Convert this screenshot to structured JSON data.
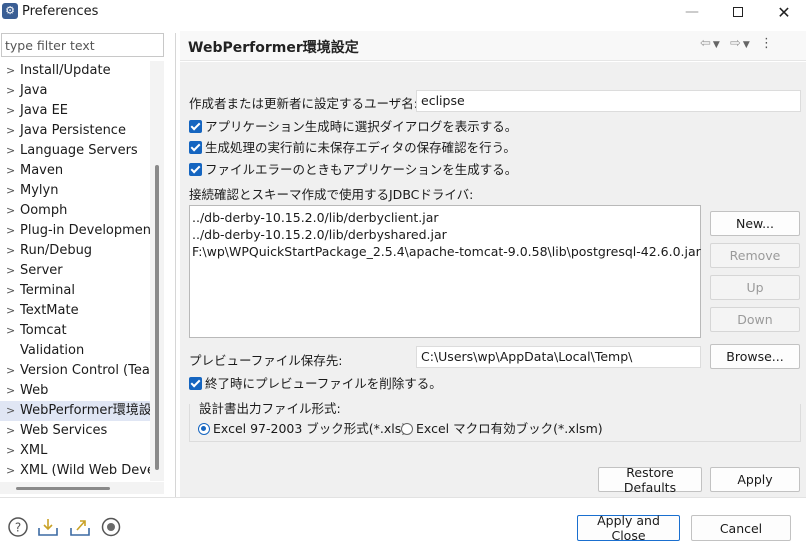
{
  "window": {
    "title": "Preferences"
  },
  "filter": {
    "placeholder": "type filter text"
  },
  "tree": {
    "items": [
      {
        "label": "Install/Update",
        "expandable": true
      },
      {
        "label": "Java",
        "expandable": true
      },
      {
        "label": "Java EE",
        "expandable": true
      },
      {
        "label": "Java Persistence",
        "expandable": true
      },
      {
        "label": "Language Servers",
        "expandable": true
      },
      {
        "label": "Maven",
        "expandable": true
      },
      {
        "label": "Mylyn",
        "expandable": true
      },
      {
        "label": "Oomph",
        "expandable": true
      },
      {
        "label": "Plug-in Development",
        "expandable": true
      },
      {
        "label": "Run/Debug",
        "expandable": true
      },
      {
        "label": "Server",
        "expandable": true
      },
      {
        "label": "Terminal",
        "expandable": true
      },
      {
        "label": "TextMate",
        "expandable": true
      },
      {
        "label": "Tomcat",
        "expandable": true
      },
      {
        "label": "Validation",
        "expandable": false
      },
      {
        "label": "Version Control (Team)",
        "expandable": true
      },
      {
        "label": "Web",
        "expandable": true
      },
      {
        "label": "WebPerformer環境設定",
        "expandable": true,
        "selected": true
      },
      {
        "label": "Web Services",
        "expandable": true
      },
      {
        "label": "XML",
        "expandable": true
      },
      {
        "label": "XML (Wild Web Developer)",
        "expandable": true
      }
    ]
  },
  "page": {
    "title": "WebPerformer環境設定",
    "user_label": "作成者または更新者に設定するユーザ名:",
    "user_value": "eclipse",
    "check1": "アプリケーション生成時に選択ダイアログを表示する。",
    "check2": "生成処理の実行前に未保存エディタの保存確認を行う。",
    "check3": "ファイルエラーのときもアプリケーションを生成する。",
    "jdbc_label": "接続確認とスキーマ作成で使用するJDBCドライバ:",
    "jdbc_list": [
      "../db-derby-10.15.2.0/lib/derbyclient.jar",
      "../db-derby-10.15.2.0/lib/derbyshared.jar",
      "F:\\wp\\WPQuickStartPackage_2.5.4\\apache-tomcat-9.0.58\\lib\\postgresql-42.6.0.jar"
    ],
    "new_label": "New...",
    "remove_label": "Remove",
    "up_label": "Up",
    "down_label": "Down",
    "preview_label": "プレビューファイル保存先:",
    "preview_value": "C:\\Users\\wp\\AppData\\Local\\Temp\\",
    "browse_label": "Browse...",
    "check4": "終了時にプレビューファイルを削除する。",
    "format_group": "設計書出力ファイル形式:",
    "radio_xls": "Excel 97-2003 ブック形式(*.xls)",
    "radio_xlsm": "Excel マクロ有効ブック(*.xlsm)",
    "restore_label": "Restore Defaults",
    "apply_label": "Apply"
  },
  "footer": {
    "apply_close_label": "Apply and Close",
    "cancel_label": "Cancel"
  },
  "colors": {
    "accent": "#1565c0",
    "selection": "#e0e6f4"
  }
}
